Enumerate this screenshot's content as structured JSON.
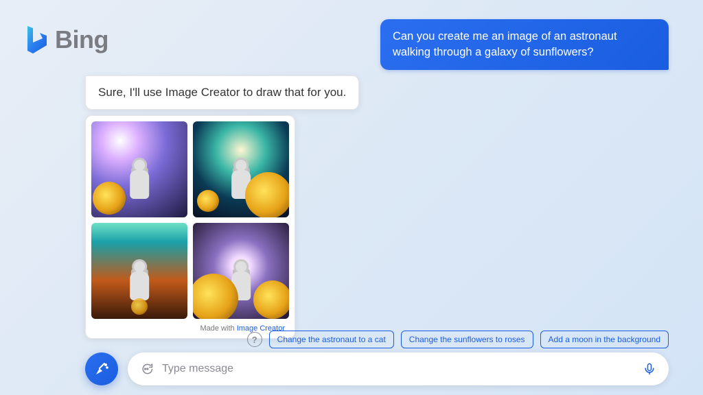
{
  "brand": {
    "name": "Bing"
  },
  "chat": {
    "user_message": "Can you create me an image of an astronaut walking through a galaxy of sunflowers?",
    "bot_reply": "Sure, I'll use Image Creator to draw that for you."
  },
  "attribution": {
    "prefix": "Made with ",
    "link_text": "Image Creator"
  },
  "suggestions": [
    "Change the astronaut to a cat",
    "Change the sunflowers to roses",
    "Add a moon in the background"
  ],
  "composer": {
    "placeholder": "Type message"
  },
  "icons": {
    "help": "?",
    "logo": "bing-logo",
    "new_topic": "broom-icon",
    "chat": "chat-icon",
    "mic": "microphone-icon"
  },
  "colors": {
    "accent": "#1a5de0",
    "user_bubble": "#2b6ff0"
  }
}
